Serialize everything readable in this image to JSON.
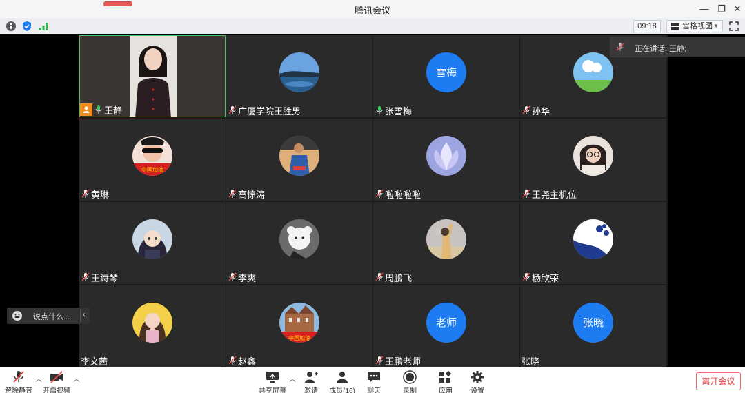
{
  "window": {
    "title": "腾讯会议"
  },
  "toolbar": {
    "clock": "09:18",
    "view_mode": "宫格视图"
  },
  "speaking": {
    "text": "正在讲话: 王静;"
  },
  "chat": {
    "placeholder": "说点什么..."
  },
  "participants": [
    {
      "name": "王静",
      "avatar": "video",
      "mic": "on",
      "host": true
    },
    {
      "name": "广厦学院王胜男",
      "avatar": "lake",
      "mic": "muted"
    },
    {
      "name": "张雪梅",
      "avatar": "text",
      "avatar_text": "雪梅",
      "mic": "on"
    },
    {
      "name": "孙华",
      "avatar": "sky",
      "mic": "muted"
    },
    {
      "name": "黄琳",
      "avatar": "red-flag-sunglasses",
      "mic": "muted"
    },
    {
      "name": "高惊涛",
      "avatar": "man-blue",
      "mic": "muted"
    },
    {
      "name": "啦啦啦啦",
      "avatar": "lotus",
      "mic": "muted"
    },
    {
      "name": "王尧主机位",
      "avatar": "girl-glasses",
      "mic": "muted"
    },
    {
      "name": "王诗琴",
      "avatar": "anime-girl",
      "mic": "muted"
    },
    {
      "name": "李爽",
      "avatar": "bear",
      "mic": "muted"
    },
    {
      "name": "周鹏飞",
      "avatar": "wave-sky",
      "mic": "muted"
    },
    {
      "name": "杨欣荣",
      "avatar": "blue-white",
      "mic": "muted"
    },
    {
      "name": "李文茜",
      "avatar": "girl-yellow",
      "mic": "none"
    },
    {
      "name": "赵鑫",
      "avatar": "castle-flag",
      "mic": "muted"
    },
    {
      "name": "王鹏老师",
      "avatar": "text",
      "avatar_text": "老师",
      "mic": "muted"
    },
    {
      "name": "张晓",
      "avatar": "text",
      "avatar_text": "张晓",
      "mic": "none"
    }
  ],
  "bottom": {
    "unmute": "解除静音",
    "start_video": "开启视频",
    "share": "共享屏幕",
    "invite": "邀请",
    "members": "成员(16)",
    "chat": "聊天",
    "record": "录制",
    "apps": "应用",
    "settings": "设置",
    "leave": "离开会议"
  },
  "colors": {
    "accent": "#1d7cf2",
    "host": "#f08c1e",
    "active_border": "#3fc15e",
    "leave": "#e23c3c"
  }
}
